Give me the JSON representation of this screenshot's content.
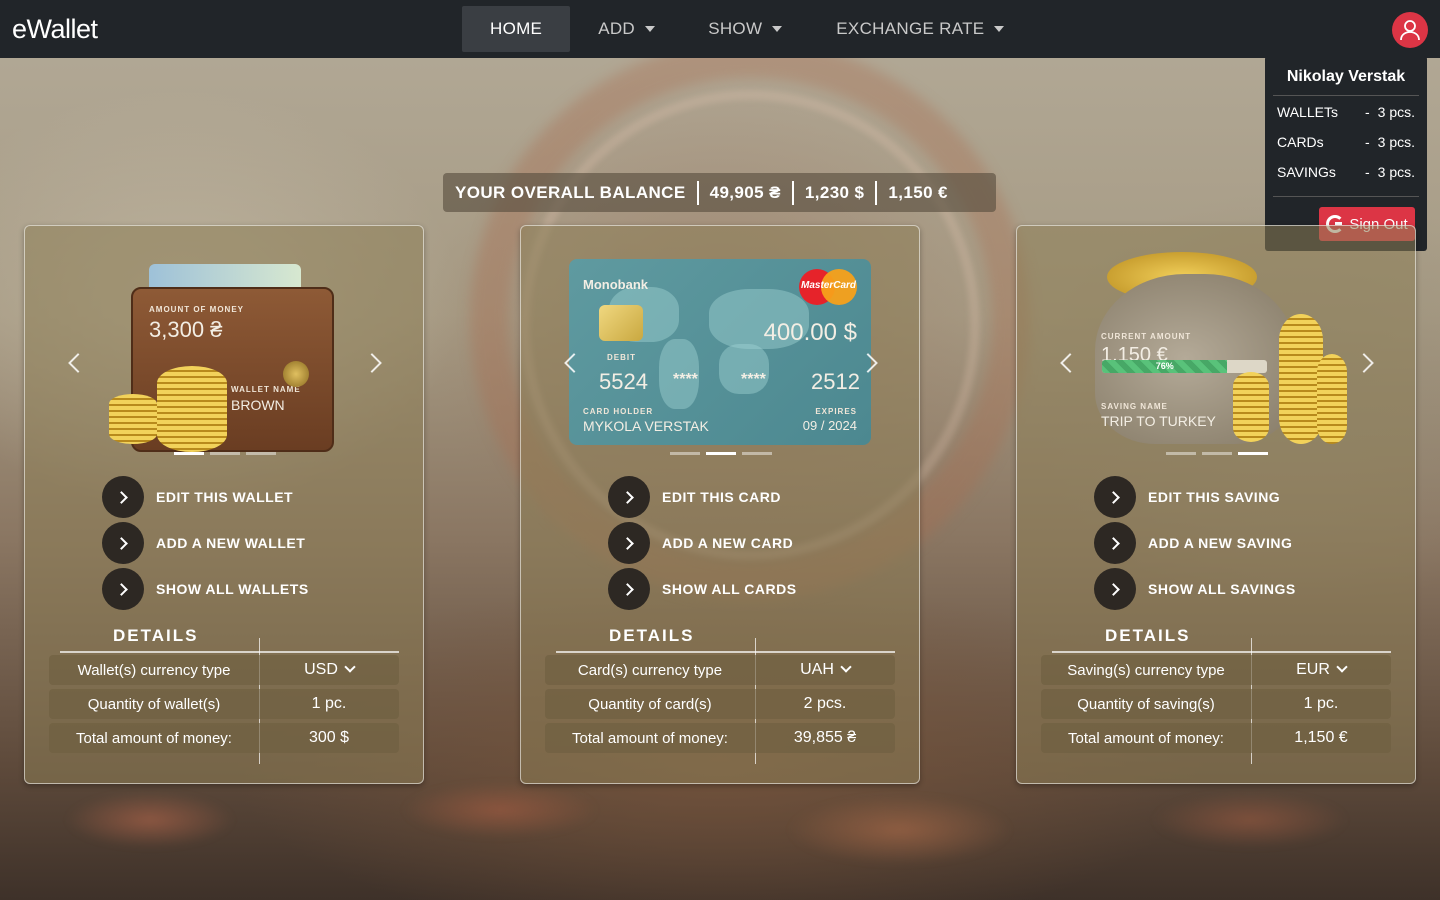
{
  "app": {
    "brand": "eWallet"
  },
  "nav": {
    "home": "HOME",
    "add": "ADD",
    "show": "SHOW",
    "exchange": "EXCHANGE RATE"
  },
  "user": {
    "name": "Nikolay Verstak",
    "stats": [
      {
        "label": "WALLETs",
        "value": "3 pcs."
      },
      {
        "label": "CARDs",
        "value": "3 pcs."
      },
      {
        "label": "SAVINGs",
        "value": "3 pcs."
      }
    ],
    "dash": "-",
    "sign_out": "Sign Out"
  },
  "balance": {
    "label": "YOUR OVERALL BALANCE",
    "uah": "49,905 ₴",
    "usd": "1,230 $",
    "eur": "1,150 €"
  },
  "wallet": {
    "amount_label": "AMOUNT OF MONEY",
    "amount": "3,300 ₴",
    "name_label": "WALLET NAME",
    "name": "BROWN",
    "actions": [
      "EDIT THIS WALLET",
      "ADD A NEW WALLET",
      "SHOW ALL WALLETS"
    ],
    "details_title": "DETAILS",
    "rows": [
      {
        "k": "Wallet(s) currency type",
        "v": "USD"
      },
      {
        "k": "Quantity of wallet(s)",
        "v": "1 pc."
      },
      {
        "k": "Total amount of money:",
        "v": "300 $"
      }
    ]
  },
  "card": {
    "bank": "Monobank",
    "brand": "MasterCard",
    "amount": "400.00 $",
    "type": "DEBIT",
    "num1": "5524",
    "mask1": "****",
    "mask2": "****",
    "num4": "2512",
    "holder_label": "CARD HOLDER",
    "holder": "MYKOLA VERSTAK",
    "expires_label": "EXPIRES",
    "expires": "09 / 2024",
    "actions": [
      "EDIT THIS CARD",
      "ADD A NEW CARD",
      "SHOW ALL CARDS"
    ],
    "details_title": "DETAILS",
    "rows": [
      {
        "k": "Card(s) currency type",
        "v": "UAH"
      },
      {
        "k": "Quantity of card(s)",
        "v": "2 pcs."
      },
      {
        "k": "Total amount of money:",
        "v": "39,855 ₴"
      }
    ]
  },
  "saving": {
    "current_label": "CURRENT AMOUNT",
    "current": "1,150 €",
    "progress": "76%",
    "progress_value": 0.76,
    "name_label": "SAVING NAME",
    "name": "TRIP TO TURKEY",
    "actions": [
      "EDIT THIS SAVING",
      "ADD A NEW SAVING",
      "SHOW ALL SAVINGS"
    ],
    "details_title": "DETAILS",
    "rows": [
      {
        "k": "Saving(s) currency type",
        "v": "EUR"
      },
      {
        "k": "Quantity of saving(s)",
        "v": "1 pc."
      },
      {
        "k": "Total amount of money:",
        "v": "1,150 €"
      }
    ]
  },
  "colors": {
    "navbar": "#212529",
    "accent_red": "#dc3545",
    "progress_green": "#59c27a"
  },
  "icons": {
    "user": "user-icon",
    "google": "google-icon",
    "chevron": "chevron-right-icon"
  }
}
